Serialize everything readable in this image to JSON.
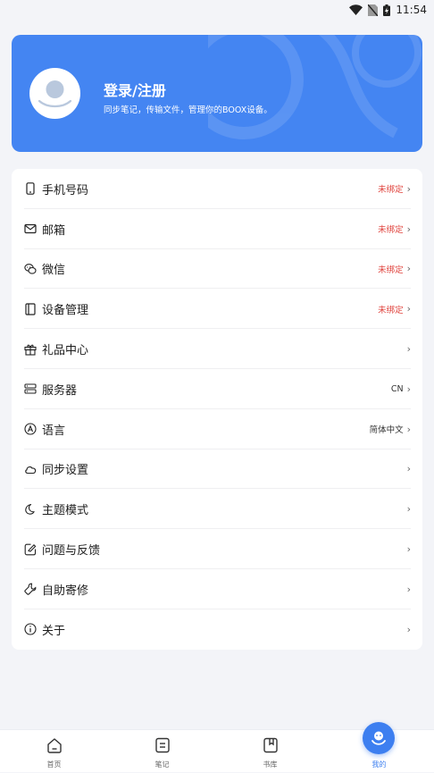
{
  "status": {
    "time": "11:54"
  },
  "profile": {
    "title": "登录/注册",
    "subtitle": "同步笔记，传输文件，管理你的BOOX设备。"
  },
  "menu": [
    {
      "id": "phone",
      "label": "手机号码",
      "value": "未绑定",
      "icon": "phone-icon"
    },
    {
      "id": "email",
      "label": "邮箱",
      "value": "未绑定",
      "icon": "mail-icon"
    },
    {
      "id": "wechat",
      "label": "微信",
      "value": "未绑定",
      "icon": "wechat-icon"
    },
    {
      "id": "devices",
      "label": "设备管理",
      "value": "未绑定",
      "icon": "device-icon"
    },
    {
      "id": "gift",
      "label": "礼品中心",
      "value": "",
      "icon": "gift-icon"
    },
    {
      "id": "server",
      "label": "服务器",
      "value": "CN",
      "icon": "server-icon"
    },
    {
      "id": "language",
      "label": "语言",
      "value": "简体中文",
      "icon": "language-icon"
    },
    {
      "id": "sync",
      "label": "同步设置",
      "value": "",
      "icon": "cloud-icon"
    },
    {
      "id": "theme",
      "label": "主题模式",
      "value": "",
      "icon": "moon-icon"
    },
    {
      "id": "feedback",
      "label": "问题与反馈",
      "value": "",
      "icon": "feedback-icon"
    },
    {
      "id": "repair",
      "label": "自助寄修",
      "value": "",
      "icon": "wrench-icon"
    },
    {
      "id": "about",
      "label": "关于",
      "value": "",
      "icon": "info-icon"
    }
  ],
  "chevron": "›",
  "nav": [
    {
      "id": "home",
      "label": "首页",
      "icon": "home-icon"
    },
    {
      "id": "notes",
      "label": "笔记",
      "icon": "notes-icon"
    },
    {
      "id": "library",
      "label": "书库",
      "icon": "library-icon"
    },
    {
      "id": "mine",
      "label": "我的",
      "icon": "mine-icon",
      "active": true
    }
  ],
  "colors": {
    "accent": "#4485f2",
    "unbound": "#e0443e",
    "background": "#f3f4f8"
  }
}
